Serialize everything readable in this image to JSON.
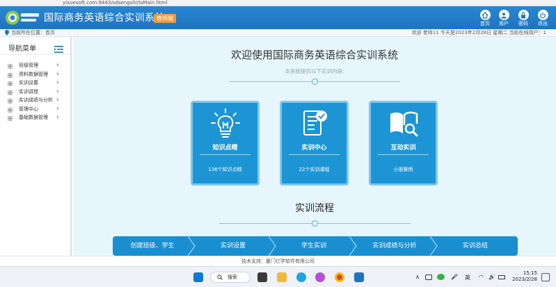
{
  "browser": {
    "url": "yixuesoft.com:9443/sdsengshi/tsMain.html"
  },
  "header": {
    "title": "国际商务英语综合实训系统",
    "edition": "教师端",
    "icons": [
      {
        "label": "首页",
        "icon": "home-icon"
      },
      {
        "label": "用户",
        "icon": "user-icon"
      },
      {
        "label": "密码",
        "icon": "lock-icon"
      },
      {
        "label": "退出",
        "icon": "power-icon"
      }
    ]
  },
  "statusbar": {
    "location": "当前所在位置：首页",
    "right": "欢迎 老师11   今天是2023年2月28日 星期二   当前在线用户：1"
  },
  "sidebar": {
    "title": "导航菜单",
    "items": [
      {
        "label": "班级管理"
      },
      {
        "label": "资料数据管理"
      },
      {
        "label": "实训设置"
      },
      {
        "label": "实训讲授"
      },
      {
        "label": "实训成绩与分析"
      },
      {
        "label": "管理中心"
      },
      {
        "label": "基础数据管理"
      }
    ]
  },
  "main": {
    "welcome": "欢迎使用国际商务英语综合实训系统",
    "subtitle": "本系统提供以下实训内容:",
    "cards": [
      {
        "title": "知识点睛",
        "sub": "136个知识点睛",
        "icon": "lightbulb-icon"
      },
      {
        "title": "实训中心",
        "sub": "22个实训课程",
        "icon": "document-check-icon"
      },
      {
        "title": "互动实训",
        "sub": "小册案例",
        "icon": "book-search-icon"
      }
    ],
    "flow_title": "实训流程",
    "flow_steps": [
      "创建班级、学生",
      "实训设置",
      "学生实训",
      "实训成绩与分析",
      "实训总结"
    ]
  },
  "footer": {
    "text": "技术支持：厦门亿学软件有限公司"
  },
  "taskbar": {
    "search": "搜索",
    "ime": "英",
    "time": "15:15",
    "date": "2023/2/28"
  },
  "colors": {
    "header": "#1d74bf",
    "card": "#1d95d5",
    "main_bg": "#e6f6fc",
    "accent": "#f29a38"
  }
}
